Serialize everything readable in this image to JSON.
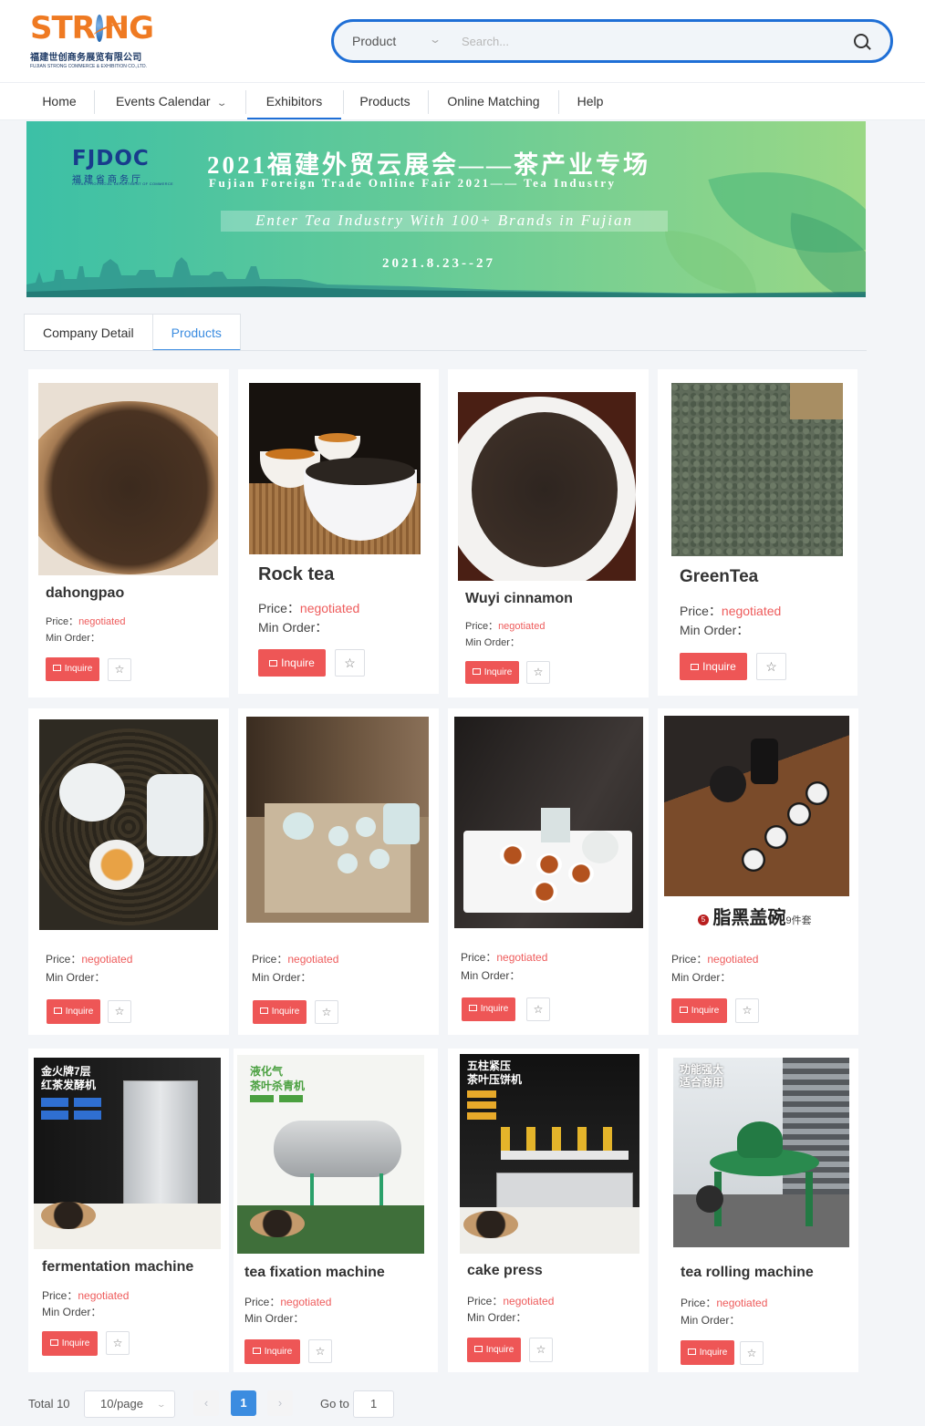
{
  "logo": {
    "word": "STRONG",
    "cn": "福建世创商务展览有限公司",
    "en": "FUJIAN STRONG COMMERCE & EXHIBITION CO.,LTD."
  },
  "search": {
    "type": "Product",
    "placeholder": "Search..."
  },
  "nav": [
    {
      "label": "Home"
    },
    {
      "label": "Events Calendar"
    },
    {
      "label": "Exhibitors"
    },
    {
      "label": "Products"
    },
    {
      "label": "Online Matching"
    },
    {
      "label": "Help"
    }
  ],
  "banner": {
    "logo": "FJDOC",
    "logo_cn": "福建省商务厅",
    "logo_en": "FUJIAN PROVINCIAL DEPARTMENT OF COMMERCE",
    "title": "2021福建外贸云展会——茶产业专场",
    "subtitle": "Fujian Foreign Trade Online Fair 2021—— Tea Industry",
    "tagline": "Enter Tea Industry  With 100+ Brands in Fujian",
    "date": "2021.8.23--27"
  },
  "tabs": [
    "Company Detail",
    "Products"
  ],
  "labels": {
    "price": "Price：",
    "min_order": "Min Order：",
    "inquire": "Inquire",
    "star": "☆"
  },
  "products": [
    {
      "name": "dahongpao",
      "price": "negotiated"
    },
    {
      "name": "Rock tea",
      "price": "negotiated"
    },
    {
      "name": "Wuyi cinnamon",
      "price": "negotiated"
    },
    {
      "name": "GreenTea",
      "price": "negotiated"
    },
    {
      "name": "",
      "price": "negotiated"
    },
    {
      "name": "",
      "price": "negotiated"
    },
    {
      "name": "",
      "price": "negotiated"
    },
    {
      "name": "",
      "price": "negotiated",
      "image_text": {
        "num": "5",
        "main": "脂黑盖碗",
        "suffix": "9件套"
      }
    },
    {
      "name": "fermentation machine",
      "price": "negotiated",
      "image_text": [
        "金火牌7层",
        "红茶发酵机"
      ]
    },
    {
      "name": "tea fixation machine",
      "price": "negotiated",
      "image_text": [
        "液化气",
        "茶叶杀青机"
      ]
    },
    {
      "name": "cake press",
      "price": "negotiated",
      "image_text": [
        "五柱紧压",
        "茶叶压饼机"
      ]
    },
    {
      "name": "tea rolling machine",
      "price": "negotiated",
      "image_text": [
        "功能强大",
        "适合商用"
      ]
    }
  ],
  "pagination": {
    "total": "Total 10",
    "page_size": "10/page",
    "prev": "‹",
    "page": "1",
    "next": "›",
    "goto_label": "Go to",
    "goto_value": "1"
  },
  "colors": {
    "accent": "#1f6fd6",
    "tab_active": "#3b8ce0",
    "price": "#ee5b5b",
    "inquire": "#ee5656",
    "logo_orange": "#ef7a22"
  }
}
